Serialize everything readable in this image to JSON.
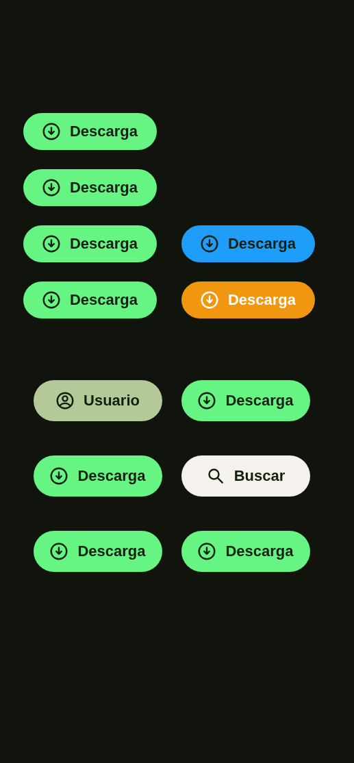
{
  "groups": [
    {
      "rows": [
        [
          {
            "label": "Descarga",
            "kind": "download",
            "color": "#66f582"
          }
        ],
        [
          {
            "label": "Descarga",
            "kind": "download",
            "color": "#66f582"
          }
        ],
        [
          {
            "label": "Descarga",
            "kind": "download",
            "color": "#66f582"
          },
          {
            "label": "Descarga",
            "kind": "download",
            "color": "#1e9df9"
          }
        ],
        [
          {
            "label": "Descarga",
            "kind": "download",
            "color": "#66f582"
          },
          {
            "label": "Descarga",
            "kind": "inverse",
            "color": "#f1960f"
          }
        ]
      ]
    },
    {
      "rows": [
        [
          {
            "label": "Usuario",
            "kind": "user",
            "color": "#b5c897"
          },
          {
            "label": "Descarga",
            "kind": "download",
            "color": "#66f582"
          }
        ],
        [
          {
            "label": "Descarga",
            "kind": "download",
            "color": "#66f582"
          },
          {
            "label": "Buscar",
            "kind": "search",
            "color": "#f5f2ed"
          }
        ],
        [
          {
            "label": "Descarga",
            "kind": "download",
            "color": "#66f582"
          },
          {
            "label": "Descarga",
            "kind": "download",
            "color": "#66f582"
          }
        ]
      ]
    }
  ]
}
